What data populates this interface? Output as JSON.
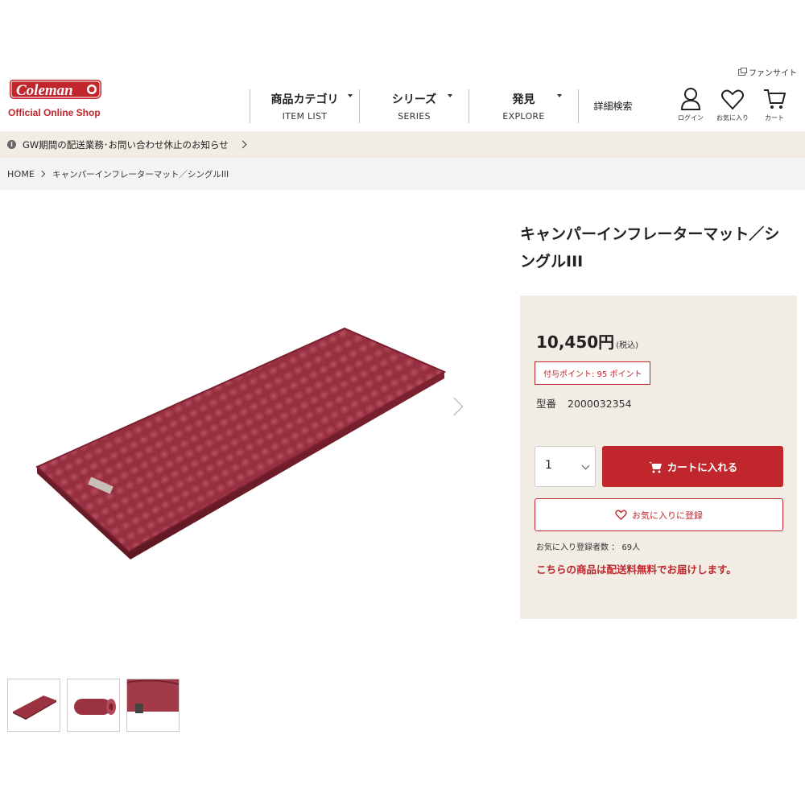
{
  "header": {
    "fan_site": "ファンサイト",
    "logo_text": "Coleman",
    "logo_sub": "Official Online Shop",
    "nav": [
      {
        "jp": "商品カテゴリ",
        "en": "ITEM LIST"
      },
      {
        "jp": "シリーズ",
        "en": "SERIES"
      },
      {
        "jp": "発見",
        "en": "EXPLORE"
      }
    ],
    "search_label": "詳細検索",
    "icons": [
      {
        "icon": "user-icon",
        "label": "ログイン"
      },
      {
        "icon": "heart-icon",
        "label": "お気に入り"
      },
      {
        "icon": "cart-icon",
        "label": "カート"
      }
    ]
  },
  "notice": {
    "text": "GW期間の配送業務･お問い合わせ休止のお知らせ"
  },
  "breadcrumb": {
    "home": "HOME",
    "current": "キャンパーインフレーターマット／シングルIII"
  },
  "product": {
    "title": "キャンパーインフレーターマット／シングルIII",
    "price": "10,450円",
    "tax_note": "(税込)",
    "points": "付与ポイント: 95 ポイント",
    "model_label": "型番",
    "model_value": "2000032354",
    "quantity": "1",
    "cart_button": "カートに入れる",
    "favorite_button": "お気に入りに登録",
    "favorite_count": "お気に入り登録者数 ： 69人",
    "free_shipping": "こちらの商品は配送料無料でお届けします。",
    "color": "#8e2a36"
  },
  "theme": {
    "accent": "#c0262c",
    "beige": "#f1ede4"
  }
}
